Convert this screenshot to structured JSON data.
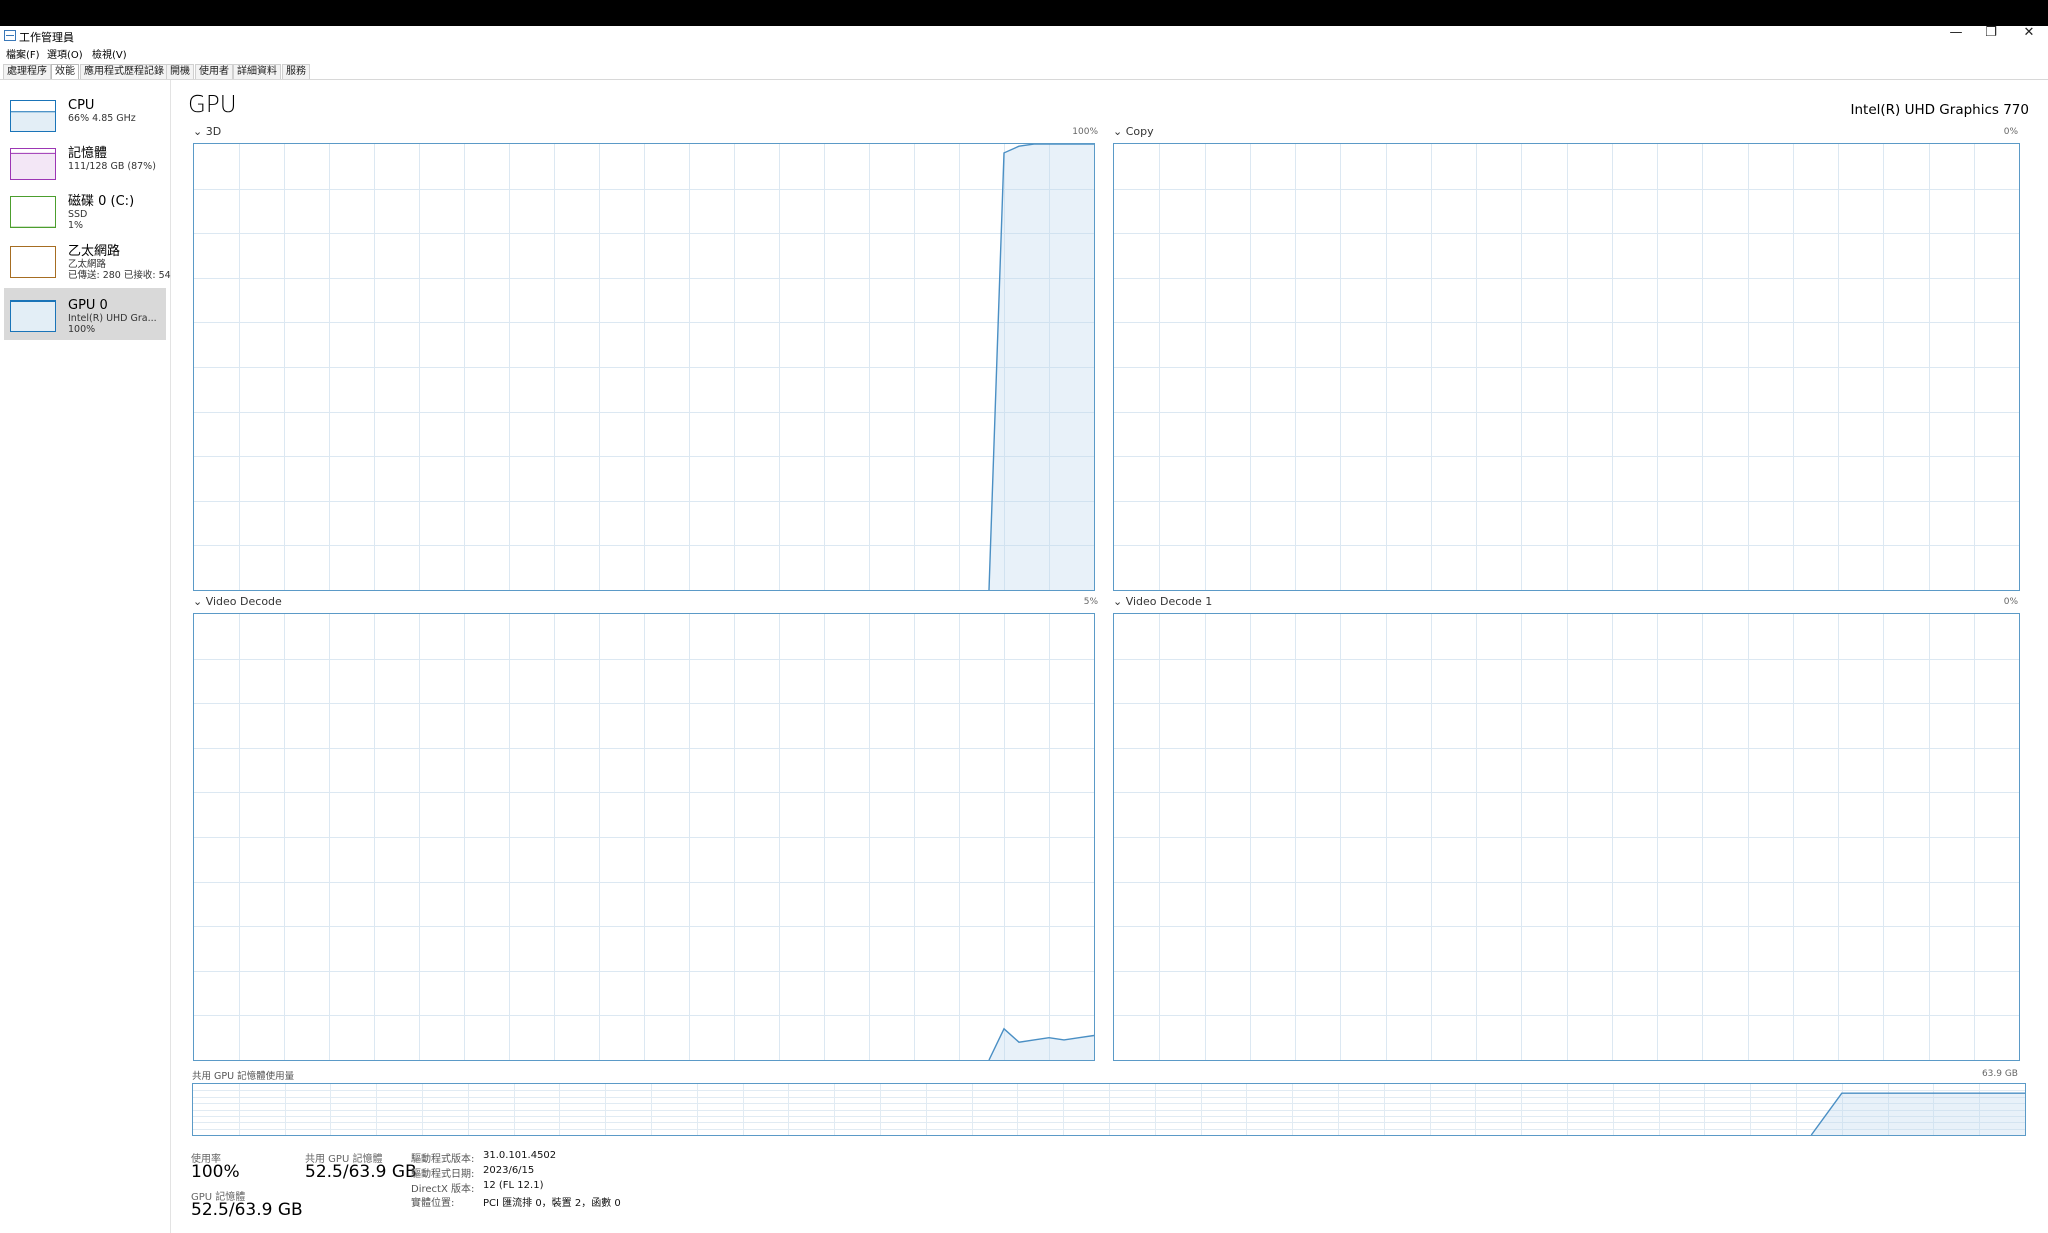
{
  "window": {
    "title": "工作管理員",
    "controls": {
      "minimize": "—",
      "restore": "❐",
      "close": "✕"
    }
  },
  "menu": [
    "檔案(F)",
    "選項(O)",
    "檢視(V)"
  ],
  "tabs": [
    {
      "label": "處理程序",
      "active": false
    },
    {
      "label": "效能",
      "active": true
    },
    {
      "label": "應用程式歷程記錄",
      "active": false
    },
    {
      "label": "開機",
      "active": false
    },
    {
      "label": "使用者",
      "active": false
    },
    {
      "label": "詳細資料",
      "active": false
    },
    {
      "label": "服務",
      "active": false
    }
  ],
  "sidebar": [
    {
      "title": "CPU",
      "sub1": "66%  4.85 GHz",
      "sub2": "",
      "sub3": "",
      "color": "#1a74b8",
      "level": 0.66
    },
    {
      "title": "記憶體",
      "sub1": "111/128 GB (87%)",
      "sub2": "",
      "sub3": "",
      "color": "#9c36b4",
      "level": 0.87
    },
    {
      "title": "磁碟 0 (C:)",
      "sub1": "SSD",
      "sub2": "1%",
      "sub3": "",
      "color": "#4c9e2e",
      "level": 0.01
    },
    {
      "title": "乙太網路",
      "sub1": "乙太網路",
      "sub2": "已傳送: 280 已接收: 54",
      "sub3": "",
      "color": "#a66d22",
      "level": 0.0
    },
    {
      "title": "GPU 0",
      "sub1": "Intel(R) UHD Gra...",
      "sub2": "100%",
      "sub3": "",
      "color": "#1a74b8",
      "level": 1.0,
      "selected": true
    }
  ],
  "header": {
    "title": "GPU",
    "model": "Intel(R) UHD Graphics 770"
  },
  "graphs": [
    {
      "label": "3D",
      "pct": "100%",
      "series": [
        0,
        0,
        0,
        0,
        0,
        0,
        0,
        0,
        0,
        0,
        0,
        0,
        0,
        0,
        0,
        0,
        0,
        0,
        0,
        0,
        0,
        0,
        0,
        0,
        0,
        0,
        0,
        0,
        0,
        0,
        0,
        0,
        0,
        0,
        0,
        0,
        0,
        0,
        0,
        0,
        0,
        0,
        0,
        0,
        0,
        0,
        0,
        0,
        0,
        0,
        0,
        0,
        0,
        0,
        98,
        99.5,
        100,
        100,
        100,
        100,
        100
      ]
    },
    {
      "label": "Copy",
      "pct": "0%",
      "series": []
    },
    {
      "label": "Video Decode",
      "pct": "5%",
      "series": [
        0,
        0,
        0,
        0,
        0,
        0,
        0,
        0,
        0,
        0,
        0,
        0,
        0,
        0,
        0,
        0,
        0,
        0,
        0,
        0,
        0,
        0,
        0,
        0,
        0,
        0,
        0,
        0,
        0,
        0,
        0,
        0,
        0,
        0,
        0,
        0,
        0,
        0,
        0,
        0,
        0,
        0,
        0,
        0,
        0,
        0,
        0,
        0,
        0,
        0,
        0,
        0,
        0,
        0,
        7,
        4,
        4.5,
        5,
        4.5,
        5,
        5.5
      ]
    },
    {
      "label": "Video Decode 1",
      "pct": "0%",
      "series": []
    }
  ],
  "shared_memory": {
    "label": "共用 GPU 記憶體使用量",
    "max": "63.9 GB",
    "series": [
      0,
      0,
      0,
      0,
      0,
      0,
      0,
      0,
      0,
      0,
      0,
      0,
      0,
      0,
      0,
      0,
      0,
      0,
      0,
      0,
      0,
      0,
      0,
      0,
      0,
      0,
      0,
      0,
      0,
      0,
      0,
      0,
      0,
      0,
      0,
      0,
      0,
      0,
      0,
      0,
      0,
      0,
      0,
      0,
      0,
      0,
      0,
      0,
      0,
      0,
      0,
      0,
      0,
      0,
      82,
      82,
      82,
      82,
      82,
      82,
      82
    ]
  },
  "stats": {
    "utilization": {
      "label": "使用率",
      "value": "100%"
    },
    "shared_gpu_memory": {
      "label": "共用 GPU 記憶體",
      "value": "52.5/63.9 GB"
    },
    "gpu_memory": {
      "label": "GPU 記憶體",
      "value": "52.5/63.9 GB"
    }
  },
  "info": [
    {
      "key": "驅動程式版本:",
      "value": "31.0.101.4502"
    },
    {
      "key": "驅動程式日期:",
      "value": "2023/6/15"
    },
    {
      "key": "DirectX 版本:",
      "value": "12 (FL 12.1)"
    },
    {
      "key": "實體位置:",
      "value": "PCI 匯流排 0，裝置 2，函數 0"
    }
  ]
}
